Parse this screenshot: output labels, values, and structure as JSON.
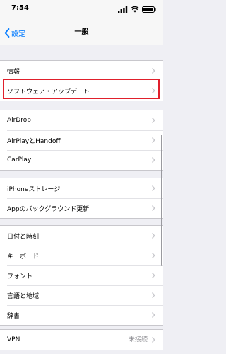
{
  "status_bar": {
    "time": "7:54"
  },
  "nav": {
    "back_label": "設定",
    "title": "一般"
  },
  "groups": [
    {
      "items": [
        {
          "label": "情報"
        },
        {
          "label": "ソフトウェア・アップデート"
        }
      ]
    },
    {
      "items": [
        {
          "label": "AirDrop"
        },
        {
          "label": "AirPlayとHandoff"
        },
        {
          "label": "CarPlay"
        }
      ]
    },
    {
      "items": [
        {
          "label": "iPhoneストレージ"
        },
        {
          "label": "Appのバックグラウンド更新"
        }
      ]
    },
    {
      "items": [
        {
          "label": "日付と時刻"
        },
        {
          "label": "キーボード"
        },
        {
          "label": "フォント"
        },
        {
          "label": "言語と地域"
        },
        {
          "label": "辞書"
        }
      ]
    },
    {
      "items": [
        {
          "label": "VPN",
          "detail": "未接続"
        }
      ]
    }
  ],
  "colors": {
    "accent": "#007aff",
    "highlight": "#e0202c",
    "background": "#efeff4"
  }
}
